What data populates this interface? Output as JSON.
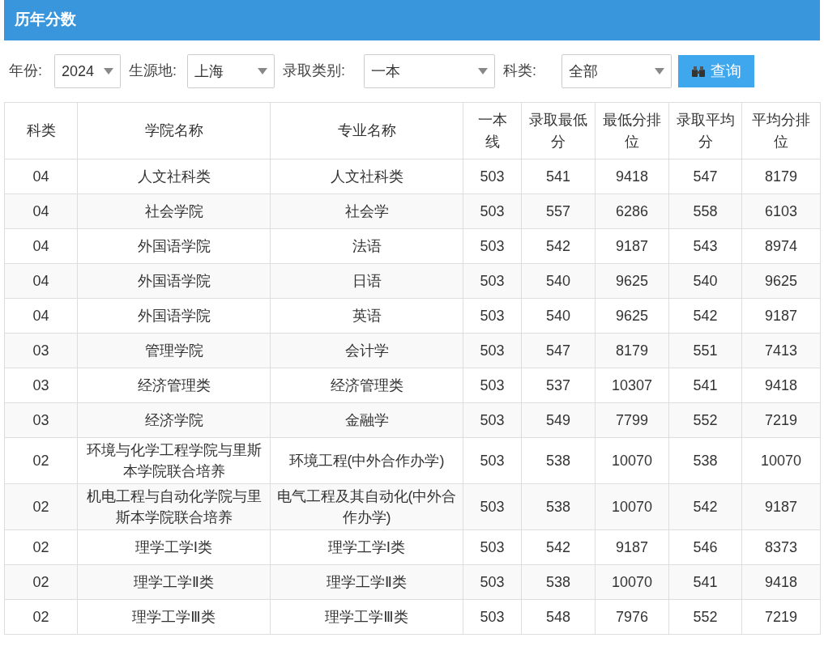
{
  "panel": {
    "title": "历年分数"
  },
  "filters": [
    {
      "label": "年份:",
      "value": "2024"
    },
    {
      "label": "生源地:",
      "value": "上海"
    },
    {
      "label": "录取类别:",
      "value": "一本"
    },
    {
      "label": "科类:",
      "value": "全部"
    }
  ],
  "query_button": {
    "label": "查询"
  },
  "table": {
    "columns": [
      "科类",
      "学院名称",
      "专业名称",
      "一本线",
      "录取最低分",
      "最低分排位",
      "录取平均分",
      "平均分排位"
    ],
    "rows": [
      [
        "04",
        "人文社科类",
        "人文社科类",
        "503",
        "541",
        "9418",
        "547",
        "8179"
      ],
      [
        "04",
        "社会学院",
        "社会学",
        "503",
        "557",
        "6286",
        "558",
        "6103"
      ],
      [
        "04",
        "外国语学院",
        "法语",
        "503",
        "542",
        "9187",
        "543",
        "8974"
      ],
      [
        "04",
        "外国语学院",
        "日语",
        "503",
        "540",
        "9625",
        "540",
        "9625"
      ],
      [
        "04",
        "外国语学院",
        "英语",
        "503",
        "540",
        "9625",
        "542",
        "9187"
      ],
      [
        "03",
        "管理学院",
        "会计学",
        "503",
        "547",
        "8179",
        "551",
        "7413"
      ],
      [
        "03",
        "经济管理类",
        "经济管理类",
        "503",
        "537",
        "10307",
        "541",
        "9418"
      ],
      [
        "03",
        "经济学院",
        "金融学",
        "503",
        "549",
        "7799",
        "552",
        "7219"
      ],
      [
        "02",
        "环境与化学工程学院与里斯本学院联合培养",
        "环境工程(中外合作办学)",
        "503",
        "538",
        "10070",
        "538",
        "10070"
      ],
      [
        "02",
        "机电工程与自动化学院与里斯本学院联合培养",
        "电气工程及其自动化(中外合作办学)",
        "503",
        "538",
        "10070",
        "542",
        "9187"
      ],
      [
        "02",
        "理学工学Ⅰ类",
        "理学工学Ⅰ类",
        "503",
        "542",
        "9187",
        "546",
        "8373"
      ],
      [
        "02",
        "理学工学Ⅱ类",
        "理学工学Ⅱ类",
        "503",
        "538",
        "10070",
        "541",
        "9418"
      ],
      [
        "02",
        "理学工学Ⅲ类",
        "理学工学Ⅲ类",
        "503",
        "548",
        "7976",
        "552",
        "7219"
      ]
    ]
  }
}
